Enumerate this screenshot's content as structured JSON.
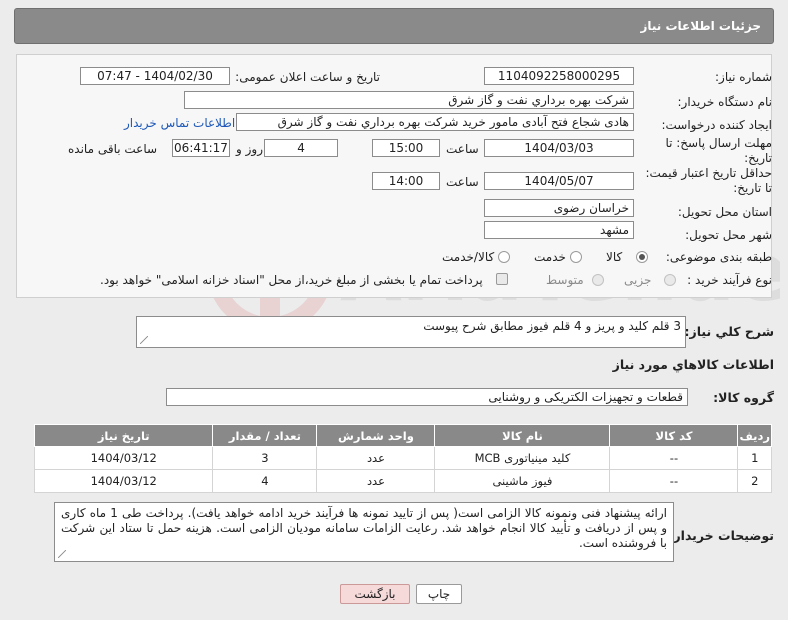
{
  "header": {
    "title": "جزئیات اطلاعات نیاز"
  },
  "form": {
    "need_number": {
      "label": "شماره نیاز:",
      "value": "1104092258000295"
    },
    "announce_datetime": {
      "label": "تاریخ و ساعت اعلان عمومی:",
      "value": "1404/02/30 - 07:47"
    },
    "buyer_org": {
      "label": "نام دستگاه خریدار:",
      "value": "شرکت بهره برداري نفت و گاز شرق"
    },
    "creator": {
      "label": "ایجاد کننده درخواست:",
      "value": "هادی شجاع فتح آبادی مامور خرید شرکت بهره برداري نفت و گاز شرق",
      "contact_link": "اطلاعات تماس خریدار"
    },
    "reply_deadline": {
      "label_line1": "مهلت ارسال پاسخ: تا",
      "label_line2": "تاریخ:",
      "date": "1404/03/03",
      "time_label": "ساعت",
      "time": "15:00",
      "days": "4",
      "days_label": "روز و",
      "remaining": "06:41:17",
      "remaining_label": "ساعت باقی مانده"
    },
    "price_validity": {
      "label_line1": "حداقل تاریخ اعتبار قیمت:",
      "label_line2": "تا تاریخ:",
      "date": "1404/05/07",
      "time_label": "ساعت",
      "time": "14:00"
    },
    "delivery_province": {
      "label": "استان محل تحویل:",
      "value": "خراسان رضوی"
    },
    "delivery_city": {
      "label": "شهر محل تحویل:",
      "value": "مشهد"
    },
    "category": {
      "label": "طبقه بندی موضوعی:",
      "options": [
        "کالا",
        "خدمت",
        "کالا/خدمت"
      ],
      "selected": "کالا"
    },
    "purchase_type": {
      "label": "نوع فرآیند خرید :",
      "options": [
        "جزیی",
        "متوسط"
      ],
      "note": "پرداخت تمام یا بخشی از مبلغ خرید،از محل \"اسناد خزانه اسلامی\" خواهد بود."
    }
  },
  "description": {
    "label": "شرح كلي نياز:",
    "value": "3 قلم کلید و پریز و 4 قلم فیوز مطابق شرح پیوست"
  },
  "goods_info": {
    "title": "اطلاعات كالاهاي مورد نياز",
    "group_label": "گروه كالا:",
    "group_value": "قطعات و تجهیزات الکتریکی و روشنایی",
    "columns": [
      "ردیف",
      "کد کالا",
      "نام کالا",
      "واحد شمارش",
      "تعداد / مقدار",
      "تاریخ نیاز"
    ],
    "rows": [
      {
        "index": "1",
        "code": "--",
        "name": "کلید مینیاتوری MCB",
        "unit": "عدد",
        "qty": "3",
        "date": "1404/03/12"
      },
      {
        "index": "2",
        "code": "--",
        "name": "فیوز ماشینی",
        "unit": "عدد",
        "qty": "4",
        "date": "1404/03/12"
      }
    ]
  },
  "buyer_notes": {
    "label": "توضیحات خریدار:",
    "value": "ارائه پیشنهاد فنی ونمونه کالا الزامی است( پس از تایید نمونه ها فرآیند خرید  ادامه خواهد یافت). پرداخت طی  1 ماه کاری و پس از دریافت و تأیید کالا انجام خواهد شد. رعایت الزامات سامانه مودیان الزامی است. هزینه حمل تا ستاد این شرکت با فروشنده است."
  },
  "buttons": {
    "print": "چاپ",
    "back": "بازگشت"
  },
  "colors": {
    "header": "#8a8a8a",
    "link": "#1d58b8",
    "back_button_bg": "#f6d9d9"
  }
}
